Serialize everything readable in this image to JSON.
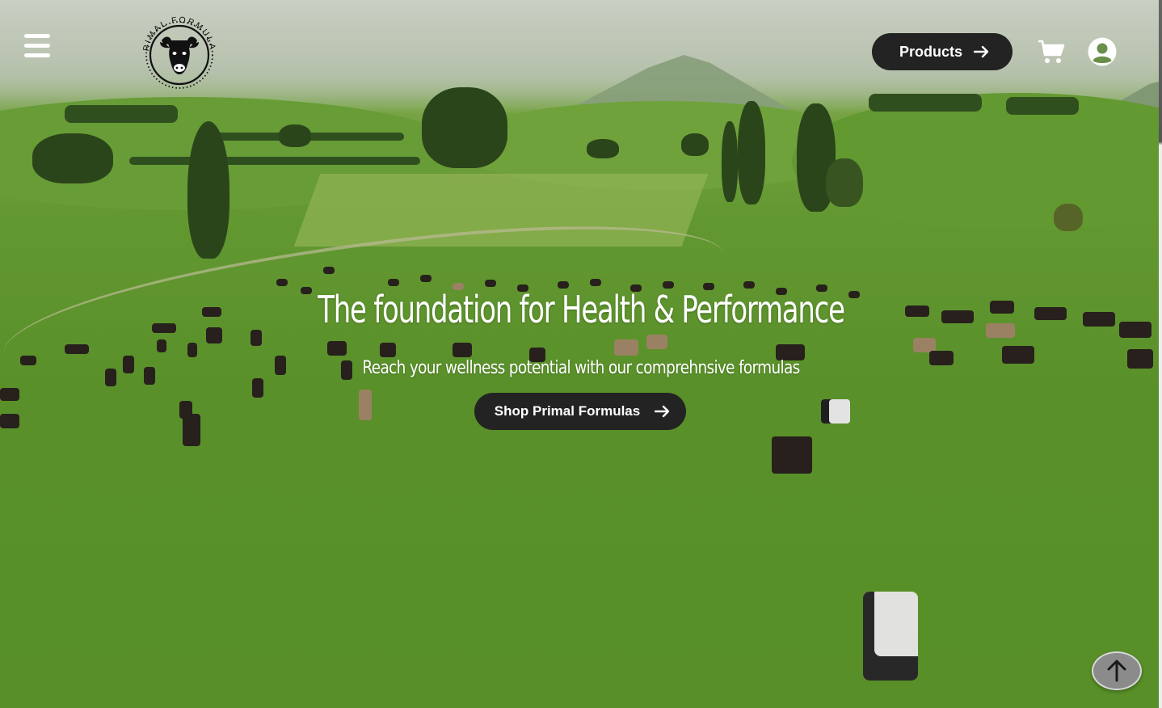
{
  "nav": {
    "menu_icon": "hamburger-menu-icon",
    "logo": {
      "text": "PRIMAL FORMULAS",
      "icon": "cow-head-logo"
    },
    "products_button": {
      "label": "Products",
      "icon": "arrow-right-icon"
    },
    "cart_icon": "shopping-cart-icon",
    "account_icon": "user-circle-icon"
  },
  "hero": {
    "title": "The foundation for Health & Performance",
    "subtitle": "Reach your wellness potential with our comprehnsive formulas",
    "cta": {
      "label": "Shop Primal Formulas",
      "icon": "arrow-right-icon"
    }
  },
  "scroll_top_icon": "arrow-up-icon",
  "colors": {
    "button_bg": "#232323",
    "button_text": "#ffffff",
    "grass": "#5f9a2c"
  }
}
